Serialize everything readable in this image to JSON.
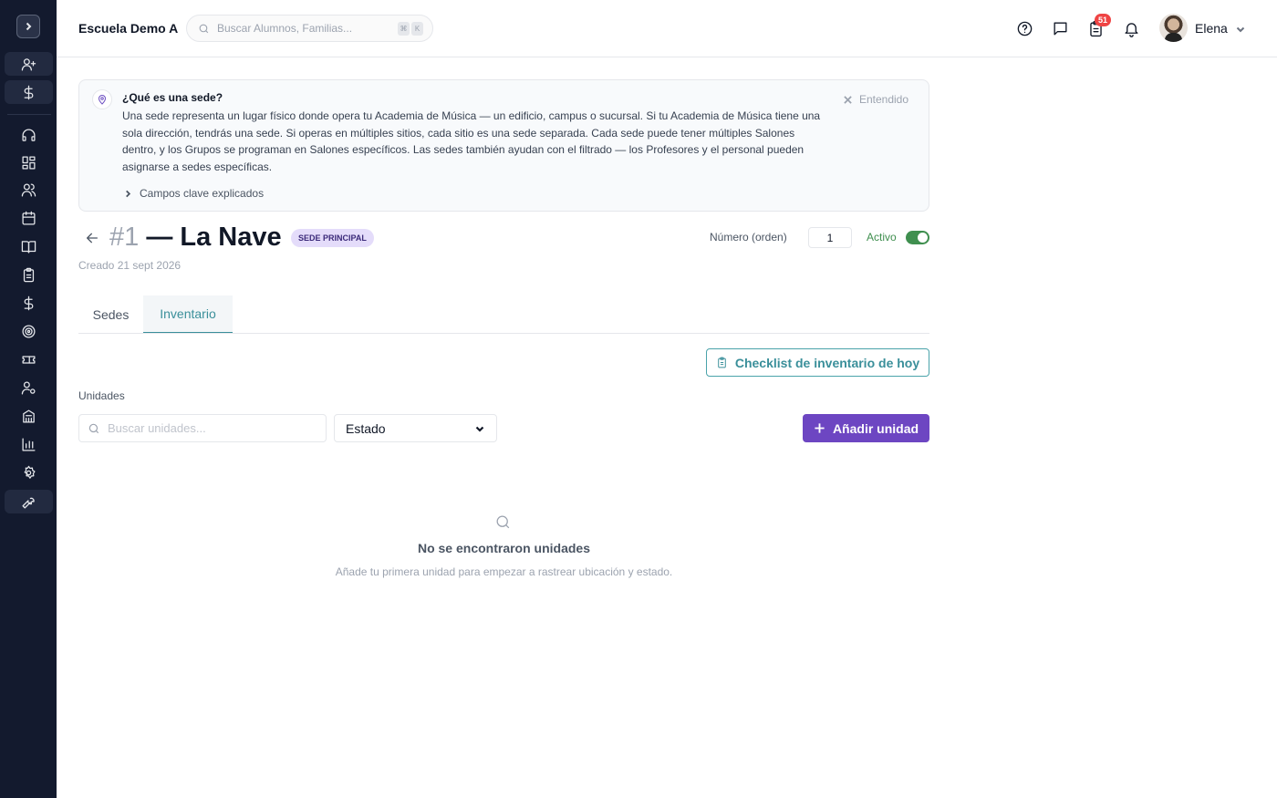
{
  "header": {
    "school_name": "Escuela Demo A",
    "search_placeholder": "Buscar Alumnos, Familias...",
    "kbd_1": "⌘",
    "kbd_2": "K",
    "notifications_count": "51",
    "user_name": "Elena"
  },
  "sidebar": {
    "items": [
      "add-user-icon",
      "dollar-icon",
      "headset-icon",
      "dashboard-icon",
      "users-icon",
      "calendar-icon",
      "book-icon",
      "clipboard-icon",
      "dollar-icon",
      "target-icon",
      "ticket-icon",
      "user-settings-icon",
      "building-icon",
      "chart-icon",
      "gear-icon",
      "wrench-icon"
    ]
  },
  "info": {
    "title": "¿Qué es una sede?",
    "body": "Una sede representa un lugar físico donde opera tu Academia de Música — un edificio, campus o sucursal. Si tu Academia de Música tiene una sola dirección, tendrás una sede. Si operas en múltiples sitios, cada sitio es una sede separada. Cada sede puede tener múltiples Salones dentro, y los Grupos se programan en Salones específicos. Las sedes también ayudan con el filtrado — los Profesores y el personal pueden asignarse a sedes específicas.",
    "dismiss": "Entendido",
    "more": "Campos clave explicados"
  },
  "page": {
    "number": "#1",
    "name": " — La Nave",
    "badge": "SEDE PRINCIPAL",
    "created": "Creado 21 sept 2026",
    "order_label": "Número (orden)",
    "order_value": "1",
    "active_label": "Activo"
  },
  "tabs": [
    {
      "label": "Sedes"
    },
    {
      "label": "Inventario"
    }
  ],
  "inventory": {
    "checklist_button": "Checklist de inventario de hoy",
    "units_label": "Unidades",
    "search_placeholder": "Buscar unidades...",
    "status_select": "Estado",
    "add_button": "Añadir unidad",
    "empty_title": "No se encontraron unidades",
    "empty_subtitle": "Añade tu primera unidad para empezar a rastrear ubicación y estado."
  },
  "colors": {
    "sidebar": "#131a2e",
    "accent_teal": "#3a8f9a",
    "accent_purple": "#6d46c2",
    "active_green": "#3f8f4f"
  }
}
